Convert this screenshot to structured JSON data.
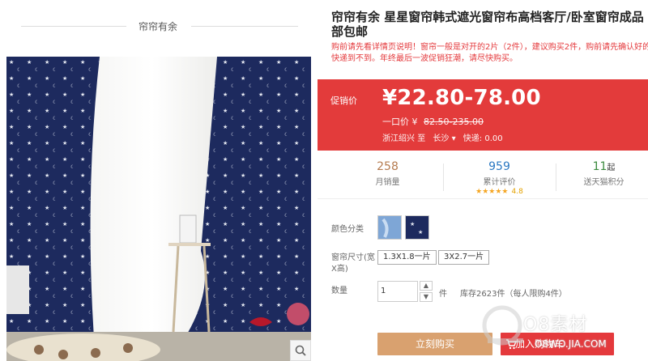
{
  "shop": {
    "name": "帘帘有余"
  },
  "product": {
    "title": "帘帘有余 星星窗帘韩式遮光窗帘布高档客厅/卧室窗帘成品部包邮",
    "subtitle": "购前请先看详情页说明！窗帘一般是对开的2片（2件），建议购买2件，购前请先确认好的快递到不到。年终最后一波促销狂潮，请尽快购买。"
  },
  "price": {
    "label": "促销价",
    "value": "¥22.80-78.00",
    "original_label": "一口价",
    "original_currency": "¥",
    "original_value": "82.50-235.00",
    "ship_from": "浙江绍兴",
    "ship_to_word": "至",
    "ship_to": "长沙",
    "ship_fee": "快递: 0.00"
  },
  "stats": {
    "monthly_sales": {
      "value": "258",
      "label": "月销量"
    },
    "reviews": {
      "value": "959",
      "label": "累计评价",
      "rating": "4.8"
    },
    "points": {
      "value": "11",
      "unit": "起",
      "label": "送天猫积分"
    }
  },
  "options": {
    "color_label": "颜色分类",
    "size_label": "窗帘尺寸(宽X高)",
    "sizes": [
      "1.3X1.8一片",
      "3X2.7一片"
    ],
    "qty_label": "数量",
    "qty_value": "1",
    "unit": "件",
    "stock": "库存2623件（每人限购4件）"
  },
  "actions": {
    "buy": "立刻购买",
    "cart": "加入购物车"
  },
  "watermark": {
    "text": "O8素材",
    "url": "O8WO.JIA.COM"
  },
  "colors": {
    "promo_red": "#e33b3b",
    "buy_tan": "#d9a16f",
    "cart_red": "#e4393c",
    "navy": "#1d2a5e"
  }
}
